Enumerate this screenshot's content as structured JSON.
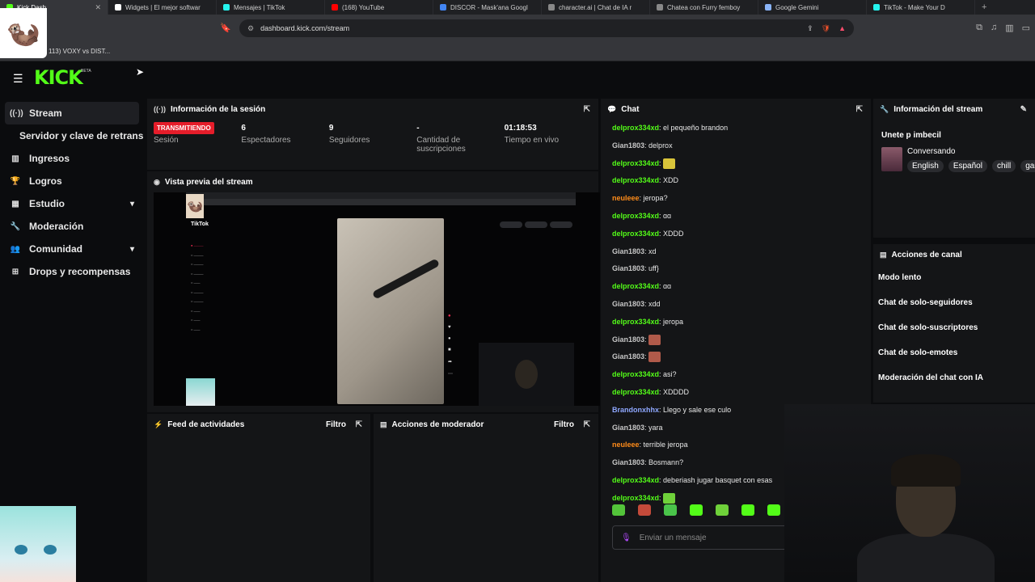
{
  "browser": {
    "tabs": [
      {
        "label": "Kick Dash",
        "active": true,
        "color": "#53fc18"
      },
      {
        "label": "Widgets | El mejor softwar",
        "active": false,
        "color": "#ffffff"
      },
      {
        "label": "Mensajes | TikTok",
        "active": false,
        "color": "#25f4ee"
      },
      {
        "label": "(168) YouTube",
        "active": false,
        "color": "#ff0000"
      },
      {
        "label": "DISCOR - Mask'ana Googl",
        "active": false,
        "color": "#4285f4"
      },
      {
        "label": "character.ai | Chat de IA r",
        "active": false,
        "color": "#888888"
      },
      {
        "label": "Chatea con Furry femboy",
        "active": false,
        "color": "#888888"
      },
      {
        "label": "Google Gemini",
        "active": false,
        "color": "#8ab4f8"
      },
      {
        "label": "TikTok - Make Your D",
        "active": false,
        "color": "#25f4ee"
      }
    ],
    "url": "dashboard.kick.com/stream",
    "bookmark": "113) VOXY vs DIST..."
  },
  "header": {
    "logo": "KICK",
    "beta": "BETA"
  },
  "sidebar": {
    "items": [
      {
        "label": "Stream",
        "icon": "broadcast-icon",
        "glyph": "((·))",
        "active": true
      },
      {
        "label": "Servidor y clave de retransmisión",
        "sub": true
      },
      {
        "label": "Ingresos",
        "icon": "chart-icon",
        "glyph": "▥"
      },
      {
        "label": "Logros",
        "icon": "trophy-icon",
        "glyph": "🏆"
      },
      {
        "label": "Estudio",
        "icon": "studio-icon",
        "glyph": "▦",
        "chevron": true
      },
      {
        "label": "Moderación",
        "icon": "wrench-icon",
        "glyph": "🔧"
      },
      {
        "label": "Comunidad",
        "icon": "people-icon",
        "glyph": "👥",
        "chevron": true
      },
      {
        "label": "Drops y recompensas",
        "icon": "drops-icon",
        "glyph": "⊞"
      }
    ]
  },
  "session": {
    "title": "Información de la sesión",
    "stats": [
      {
        "value": "TRANSMITIENDO",
        "label": "Sesión",
        "badge": true
      },
      {
        "value": "6",
        "label": "Espectadores"
      },
      {
        "value": "9",
        "label": "Seguidores"
      },
      {
        "value": "-",
        "label": "Cantidad de suscripciones"
      },
      {
        "value": "01:18:53",
        "label": "Tiempo en vivo"
      }
    ]
  },
  "preview": {
    "title": "Vista previa del stream",
    "tiktok_label": "TikTok"
  },
  "activity": {
    "title": "Feed de actividades",
    "filter": "Filtro"
  },
  "moderator": {
    "title": "Acciones de moderador",
    "filter": "Filtro"
  },
  "chat": {
    "title": "Chat",
    "messages": [
      {
        "user": "delprox334xd",
        "color": "#53fc18",
        "text": "el pequeño brandon"
      },
      {
        "user": "Gian1803",
        "color": "#c7c7c7",
        "text": "delprox"
      },
      {
        "user": "delprox334xd",
        "color": "#53fc18",
        "text": "",
        "emote": "#d9c43a"
      },
      {
        "user": "delprox334xd",
        "color": "#53fc18",
        "text": "XDD"
      },
      {
        "user": "neuleee",
        "color": "#ff8c1a",
        "text": "jeropa?"
      },
      {
        "user": "delprox334xd",
        "color": "#53fc18",
        "text": "ɑɑ"
      },
      {
        "user": "delprox334xd",
        "color": "#53fc18",
        "text": "XDDD"
      },
      {
        "user": "Gian1803",
        "color": "#c7c7c7",
        "text": "xd"
      },
      {
        "user": "Gian1803",
        "color": "#c7c7c7",
        "text": "uff}"
      },
      {
        "user": "delprox334xd",
        "color": "#53fc18",
        "text": "ɑɑ"
      },
      {
        "user": "Gian1803",
        "color": "#c7c7c7",
        "text": "xdd"
      },
      {
        "user": "delprox334xd",
        "color": "#53fc18",
        "text": "jeropa"
      },
      {
        "user": "Gian1803",
        "color": "#c7c7c7",
        "text": "",
        "emote": "#b05a4a"
      },
      {
        "user": "Gian1803",
        "color": "#c7c7c7",
        "text": "",
        "emote": "#b05a4a"
      },
      {
        "user": "delprox334xd",
        "color": "#53fc18",
        "text": "asi?"
      },
      {
        "user": "delprox334xd",
        "color": "#53fc18",
        "text": "XDDDD"
      },
      {
        "user": "Brandonxhhx",
        "color": "#8fa8ff",
        "text": "Llego y sale ese culo"
      },
      {
        "user": "Gian1803",
        "color": "#c7c7c7",
        "text": "yara"
      },
      {
        "user": "neuleee",
        "color": "#ff8c1a",
        "text": "terrible jeropa"
      },
      {
        "user": "Gian1803",
        "color": "#c7c7c7",
        "text": "Bosmann?"
      },
      {
        "user": "delprox334xd",
        "color": "#53fc18",
        "text": "deberiash jugar basquet con esas"
      },
      {
        "user": "delprox334xd",
        "color": "#53fc18",
        "text": "",
        "emote": "#6fd13a"
      }
    ],
    "emotes": [
      "#53c43a",
      "#c44a3a",
      "#4ac44a",
      "#53fc18",
      "#6fd13a",
      "#53fc18",
      "#53fc18"
    ],
    "input_placeholder": "Enviar un mensaje"
  },
  "stream_info": {
    "title": "Información del stream",
    "stream_title": "Unete p imbecil",
    "category": "Conversando",
    "tags": [
      "English",
      "Español",
      "chill",
      "gam"
    ]
  },
  "channel_actions": {
    "title": "Acciones de canal",
    "items": [
      {
        "label": "Modo lento",
        "toggle": false
      },
      {
        "label": "Chat de solo-seguidores",
        "toggle": false
      },
      {
        "label": "Chat de solo-suscriptores",
        "toggle": true
      },
      {
        "label": "Chat de solo-emotes",
        "toggle": true
      },
      {
        "label": "Moderación del chat con IA",
        "toggle": false
      }
    ]
  }
}
